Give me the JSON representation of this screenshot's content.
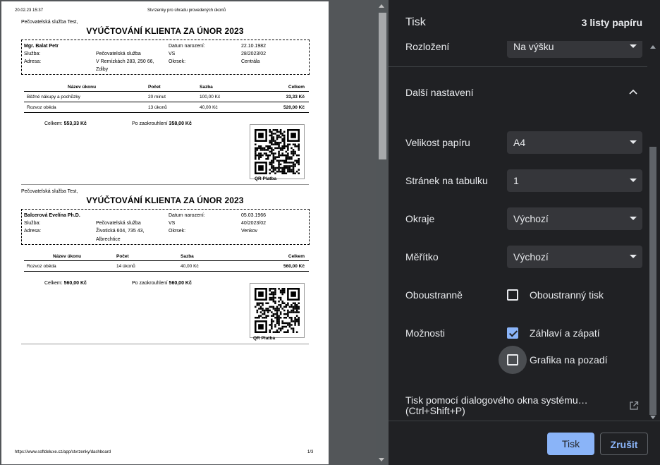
{
  "preview": {
    "header_left": "20.02.23 15:37",
    "header_center": "Stvrzenky pro úhradu provedených úkonů",
    "footer_left": "https://www.softdeluxe.cz/app/stvrzenky/dashboard",
    "footer_right": "1/3",
    "sections": [
      {
        "org": "Pečovatelská služba Test,",
        "title": "VYÚČTOVÁNÍ KLIENTA ZA ÚNOR 2023",
        "client_name": "Mgr. Balat Petr",
        "service_label": "Služba:",
        "service_value": "Pečovatelská služba",
        "address_label": "Adresa:",
        "address_line1": "V Remízkách 283, 250 66,",
        "address_line2": "Zdiby",
        "dob_label": "Datum narození:",
        "dob_value": "22.10.1982",
        "vs_label": "VS",
        "vs_value": "28/2023/02",
        "district_label": "Okrsek:",
        "district_value": "Centrála",
        "table_headers": [
          "Název úkonu",
          "Počet",
          "Sazba",
          "Celkem"
        ],
        "rows": [
          [
            "Běžné nákupy a pochůzky",
            "20 minut",
            "100,00 Kč",
            "33,33 Kč"
          ],
          [
            "Rozvoz oběda",
            "13 úkonů",
            "40,00 Kč",
            "520,00 Kč"
          ]
        ],
        "total_label": "Celkem:",
        "total_value": "553,33 Kč",
        "rounded_label": "Po zaokrouhlení",
        "rounded_value": "358,00 Kč",
        "qr_label": "QR Platba"
      },
      {
        "org": "Pečovatelská služba Test,",
        "title": "VYÚČTOVÁNÍ KLIENTA ZA ÚNOR 2023",
        "client_name": "Balcerová Evelína Ph.D.",
        "service_label": "Služba:",
        "service_value": "Pečovatelská služba",
        "address_label": "Adresa:",
        "address_line1": "Životická 604, 735 43,",
        "address_line2": "Albrechtice",
        "dob_label": "Datum narození:",
        "dob_value": "05.03.1966",
        "vs_label": "VS",
        "vs_value": "40/2023/02",
        "district_label": "Okrsek:",
        "district_value": "Venkov",
        "table_headers": [
          "Název úkonu",
          "Počet",
          "Sazba",
          "Celkem"
        ],
        "rows": [
          [
            "Rozvoz oběda",
            "14 úkonů",
            "40,00 Kč",
            "560,00 Kč"
          ]
        ],
        "total_label": "Celkem:",
        "total_value": "560,00 Kč",
        "rounded_label": "Po zaokrouhlení",
        "rounded_value": "560,00 Kč",
        "qr_label": "QR Platba"
      }
    ]
  },
  "dialog": {
    "title": "Tisk",
    "sheets": "3 listy papíru",
    "layout_label": "Rozložení",
    "layout_value": "Na výšku",
    "more_settings": "Další nastavení",
    "paper_size_label": "Velikost papíru",
    "paper_size_value": "A4",
    "pages_per_sheet_label": "Stránek na tabulku",
    "pages_per_sheet_value": "1",
    "margins_label": "Okraje",
    "margins_value": "Výchozí",
    "scale_label": "Měřítko",
    "scale_value": "Výchozí",
    "duplex_label": "Oboustranně",
    "duplex_option": "Oboustranný tisk",
    "options_label": "Možnosti",
    "headers_footers_option": "Záhlaví a zápatí",
    "background_graphics_option": "Grafika na pozadí",
    "system_dialog_line1": "Tisk pomocí dialogového okna systému…",
    "system_dialog_line2": "(Ctrl+Shift+P)",
    "print_button": "Tisk",
    "cancel_button": "Zrušit",
    "accent": "#8ab4f8"
  }
}
